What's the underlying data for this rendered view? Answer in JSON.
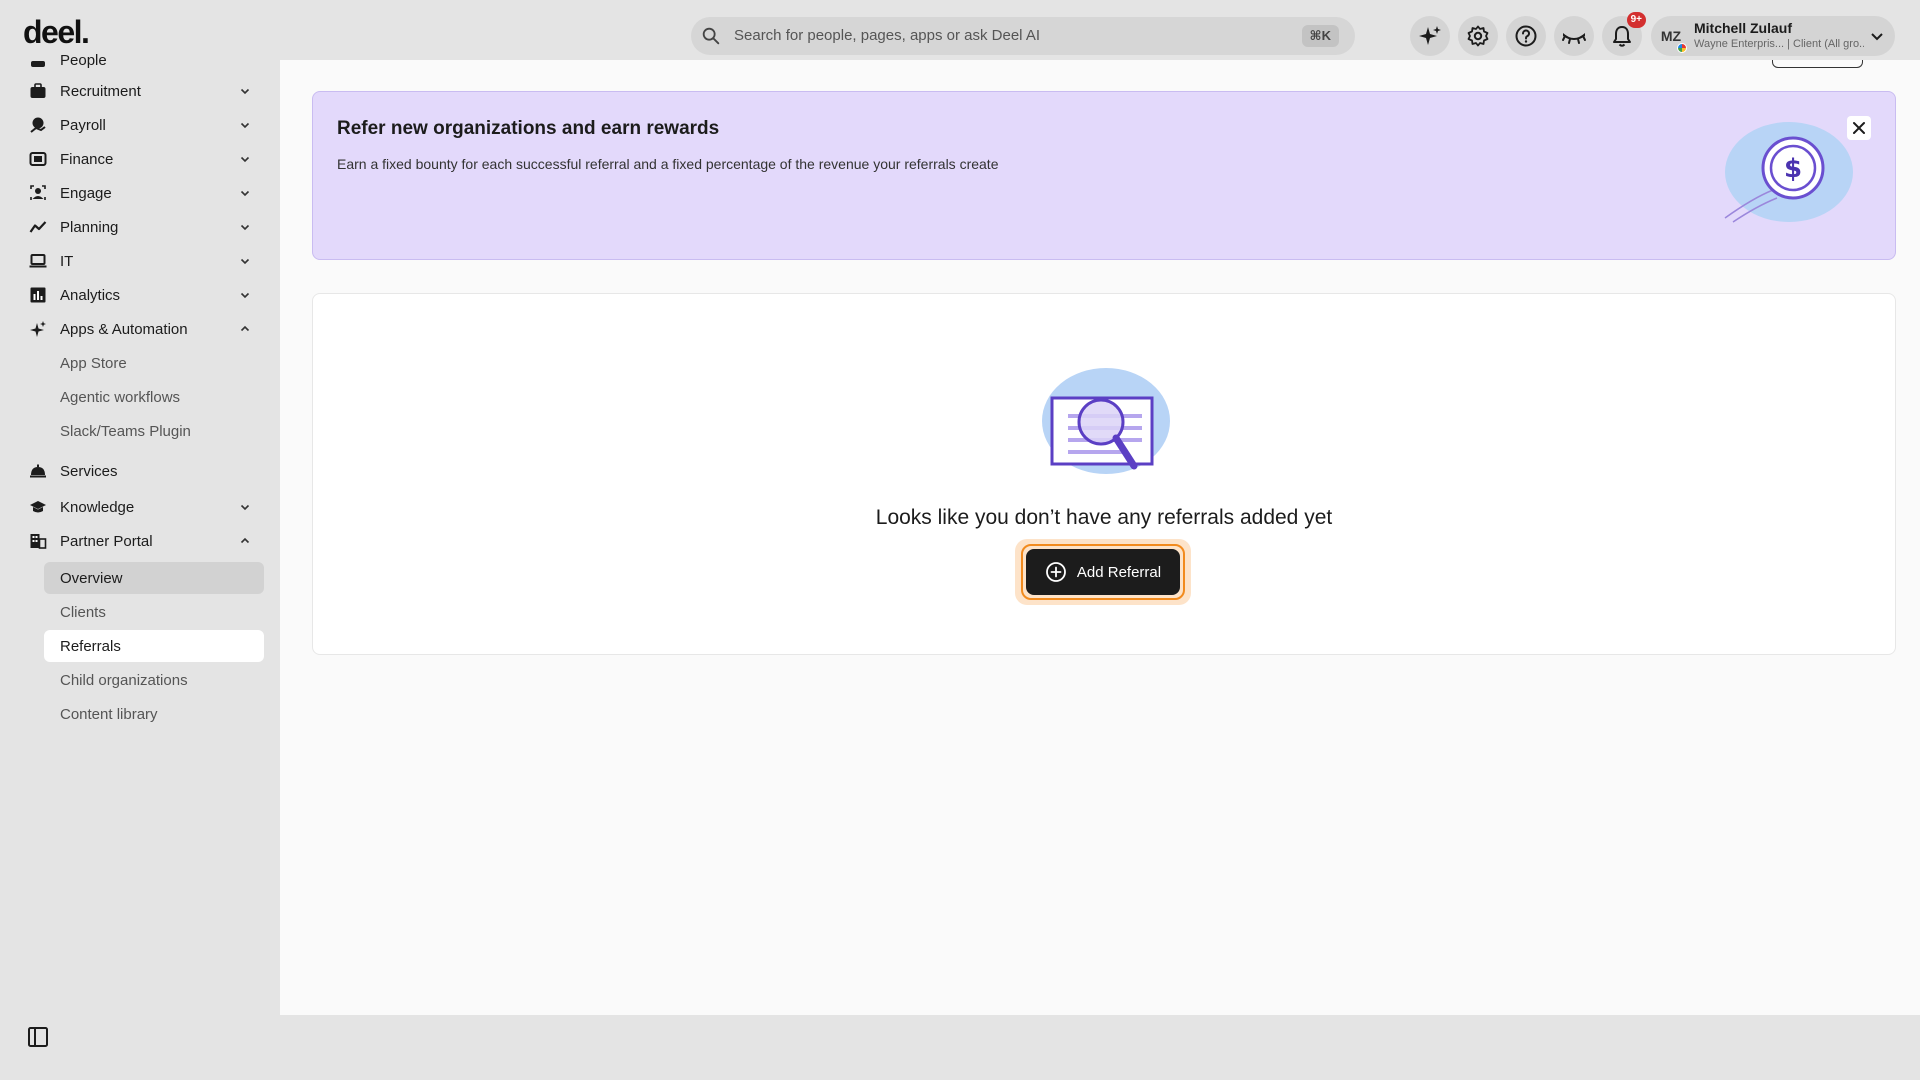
{
  "header": {
    "logo": "deel.",
    "search_placeholder": "Search for people, pages, apps or ask Deel AI",
    "search_shortcut": "⌘K",
    "notifications_badge": "9+",
    "user": {
      "initials": "MZ",
      "name": "Mitchell Zulauf",
      "subtitle": "Wayne Enterpris... | Client (All gro..."
    }
  },
  "sidebar": {
    "partial_top_label": "People",
    "items": [
      {
        "label": "Recruitment",
        "icon": "briefcase-icon"
      },
      {
        "label": "Payroll",
        "icon": "payroll-icon"
      },
      {
        "label": "Finance",
        "icon": "finance-icon"
      },
      {
        "label": "Engage",
        "icon": "engage-icon"
      },
      {
        "label": "Planning",
        "icon": "trend-icon"
      },
      {
        "label": "IT",
        "icon": "laptop-icon"
      },
      {
        "label": "Analytics",
        "icon": "analytics-icon"
      },
      {
        "label": "Apps & Automation",
        "icon": "sparkle-icon"
      },
      {
        "label": "Services",
        "icon": "service-bell-icon"
      },
      {
        "label": "Knowledge",
        "icon": "graduation-cap-icon"
      },
      {
        "label": "Partner Portal",
        "icon": "building-icon"
      }
    ],
    "apps_sub": [
      "App Store",
      "Agentic workflows",
      "Slack/Teams Plugin"
    ],
    "partner_sub": [
      "Overview",
      "Clients",
      "Referrals",
      "Child organizations",
      "Content library"
    ]
  },
  "banner": {
    "title": "Refer new organizations and earn rewards",
    "text": "Earn a fixed bounty for each successful referral and a fixed percentage of the revenue your referrals create"
  },
  "empty_state": {
    "message": "Looks like you don’t have any referrals added yet",
    "button_label": "Add Referral"
  },
  "colors": {
    "banner_bg": "#e3d9fb",
    "accent_purple": "#5b3fc4",
    "button_bg": "#1c1c1c",
    "focus_ring": "#f28b1e"
  }
}
